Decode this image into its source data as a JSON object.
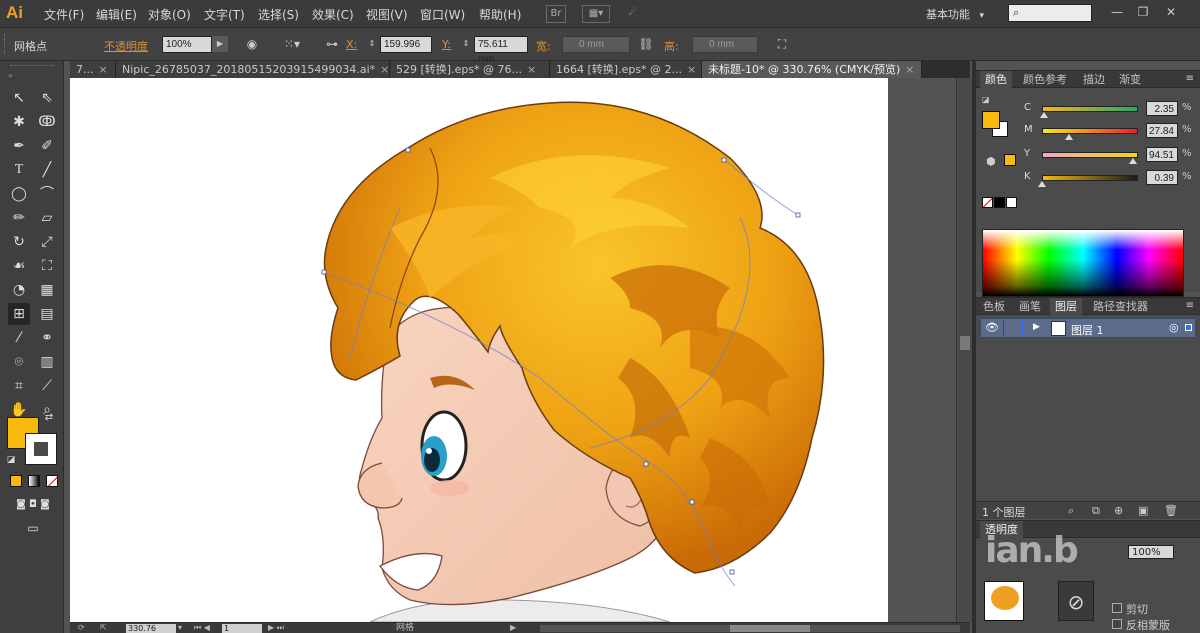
{
  "app": {
    "logo": "Ai"
  },
  "menu": [
    "文件(F)",
    "编辑(E)",
    "对象(O)",
    "文字(T)",
    "选择(S)",
    "效果(C)",
    "视图(V)",
    "窗口(W)",
    "帮助(H)"
  ],
  "menubar_icons": [
    "br-icon",
    "layout-icon",
    "gpu-icon"
  ],
  "workspace": {
    "label": "基本功能",
    "arrow": "▾"
  },
  "search": {
    "placeholder": ""
  },
  "window_buttons": [
    "—",
    "❐",
    "✕"
  ],
  "control": {
    "mode": "网格点",
    "opacity_label": "不透明度",
    "opacity_value": "100%",
    "x_label": "X:",
    "x_value": "159.996",
    "y_label": "Y:",
    "y_value": "75.611 mm",
    "w_label": "宽:",
    "w_value": "0 mm",
    "h_label": "高:",
    "h_value": "0 mm"
  },
  "tabs": [
    {
      "label": "7...",
      "close": "×"
    },
    {
      "label": "Nipic_26785037_20180515203915499034.ai*",
      "close": "×"
    },
    {
      "label": "529 [转换].eps* @ 76...",
      "close": "×"
    },
    {
      "label": "1664 [转换].eps* @ 2...",
      "close": "×"
    },
    {
      "label": "未标题-10* @ 330.76% (CMYK/预览)",
      "close": "×"
    }
  ],
  "status": {
    "zoom": "330.76",
    "page": "1",
    "tool_name": "网格"
  },
  "color_panel": {
    "tabs": [
      "颜色",
      "颜色参考",
      "描边",
      "渐变"
    ],
    "fill_color": "#f7b90c",
    "sliders": [
      {
        "label": "C",
        "value": "2.35",
        "fraction": 0.0235,
        "gradient": "linear-gradient(to right,#f7b90c,#2aa46a)"
      },
      {
        "label": "M",
        "value": "27.84",
        "fraction": 0.2784,
        "gradient": "linear-gradient(to right,#f9ec16,#e8202a)"
      },
      {
        "label": "Y",
        "value": "94.51",
        "fraction": 0.9451,
        "gradient": "linear-gradient(to right,#f1a6c8,#f7d40c)"
      },
      {
        "label": "K",
        "value": "0.39",
        "fraction": 0.0039,
        "gradient": "linear-gradient(to right,#f7b90c,#1a1a1a)"
      }
    ],
    "percent": "%"
  },
  "layers_panel": {
    "tabs": [
      "色板",
      "画笔",
      "图层",
      "路径查找器"
    ],
    "layer_name": "图层 1",
    "count": "1 个图层"
  },
  "transparency_panel": {
    "title": "透明度",
    "opacity": "100%",
    "options": [
      "剪切",
      "反相蒙版"
    ]
  },
  "watermark": "ian.b"
}
